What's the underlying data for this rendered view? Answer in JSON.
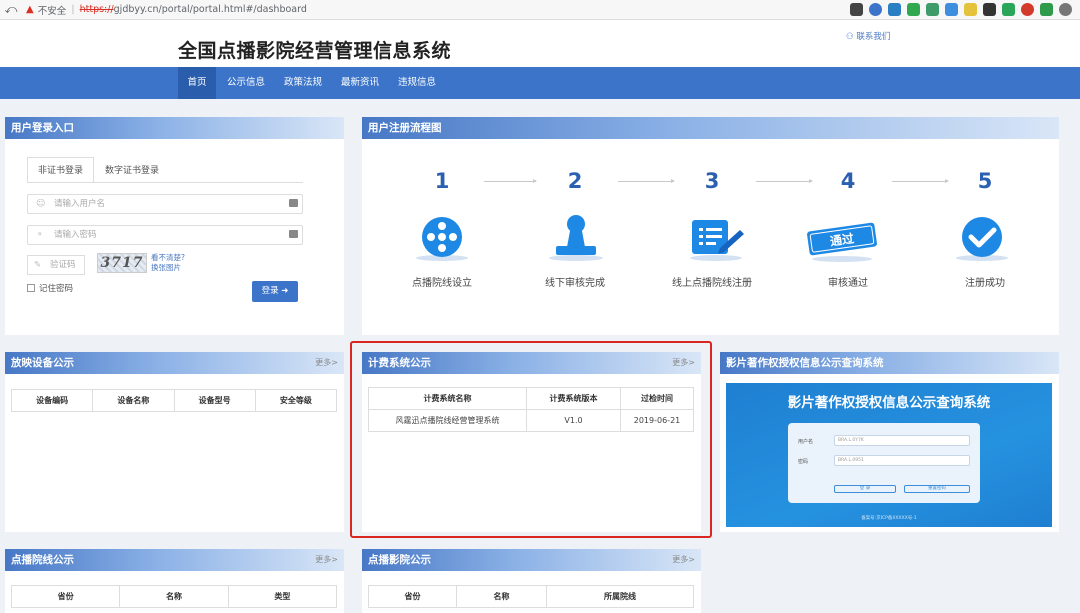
{
  "browser": {
    "back": "⤺",
    "warning": "▲",
    "insecure": "不安全",
    "separator": "|",
    "scheme": "https://",
    "url_rest": "gjdbyy.cn/portal/portal.html#/dashboard"
  },
  "header": {
    "title": "全国点播影院经营管理信息系统",
    "contact": "联系我们"
  },
  "nav": [
    "首页",
    "公示信息",
    "政策法规",
    "最新资讯",
    "违规信息"
  ],
  "login": {
    "title": "用户登录入口",
    "tabs": [
      "非证书登录",
      "数字证书登录"
    ],
    "username_placeholder": "请输入用户名",
    "password_placeholder": "请输入密码",
    "captcha_placeholder": "验证码",
    "captcha_code": "3717",
    "captcha_help_1": "看不清楚?",
    "captcha_help_2": "换张图片",
    "remember": "记住密码",
    "login_button": "登录"
  },
  "register": {
    "title": "用户注册流程图",
    "steps": [
      {
        "num": "1",
        "label": "点播院线设立",
        "icon": "film-reel-icon"
      },
      {
        "num": "2",
        "label": "线下审核完成",
        "icon": "stamp-icon"
      },
      {
        "num": "3",
        "label": "线上点播院线注册",
        "icon": "form-pen-icon"
      },
      {
        "num": "4",
        "label": "审核通过",
        "icon": "approved-stamp-icon",
        "stamp_text": "通过"
      },
      {
        "num": "5",
        "label": "注册成功",
        "icon": "check-circle-icon"
      }
    ]
  },
  "equipment": {
    "title": "放映设备公示",
    "more": "更多>",
    "headers": [
      "设备编码",
      "设备名称",
      "设备型号",
      "安全等级"
    ]
  },
  "billing": {
    "title": "计费系统公示",
    "more": "更多>",
    "headers": [
      "计费系统名称",
      "计费系统版本",
      "过检时间"
    ],
    "rows": [
      [
        "风霆迅点播院线经营管理系统",
        "V1.0",
        "2019-06-21"
      ]
    ]
  },
  "copyright": {
    "title": "影片著作权授权信息公示查询系统",
    "image_title": "影片著作权授权信息公示查询系统",
    "username_label": "用户名",
    "password_label": "密码",
    "username_value": "BRA.L.0Y7K",
    "password_value": "BRA.L.0951",
    "login_label": "登 录",
    "reset_label": "重置密码",
    "footer": "备案号:京ICP备XXXXX号-1"
  },
  "lines": {
    "title": "点播院线公示",
    "more": "更多>",
    "headers": [
      "省份",
      "名称",
      "类型"
    ]
  },
  "cinemas": {
    "title": "点播影院公示",
    "more": "更多>",
    "headers": [
      "省份",
      "名称",
      "所属院线"
    ]
  }
}
